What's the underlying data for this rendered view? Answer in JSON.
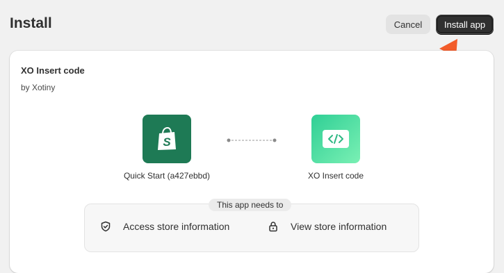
{
  "header": {
    "title": "Install",
    "cancel_label": "Cancel",
    "install_label": "Install app"
  },
  "app": {
    "name": "XO Insert code",
    "author": "by Xotiny"
  },
  "connection": {
    "store_name": "Quick Start (a427ebbd)",
    "store_icon": "shopify-bag-icon",
    "app_name": "XO Insert code",
    "app_icon": "code-icon"
  },
  "permissions": {
    "heading": "This app needs to",
    "items": [
      {
        "label": "Access store information",
        "icon": "shield-check-icon"
      },
      {
        "label": "View store information",
        "icon": "lock-icon"
      }
    ]
  },
  "colors": {
    "page_bg": "#f1f1f1",
    "primary_button": "#303030",
    "store_tile": "#1e7a55",
    "app_tile_start": "#2fcf95",
    "app_tile_end": "#7af0b4",
    "annotation_arrow": "#f25c2a"
  }
}
